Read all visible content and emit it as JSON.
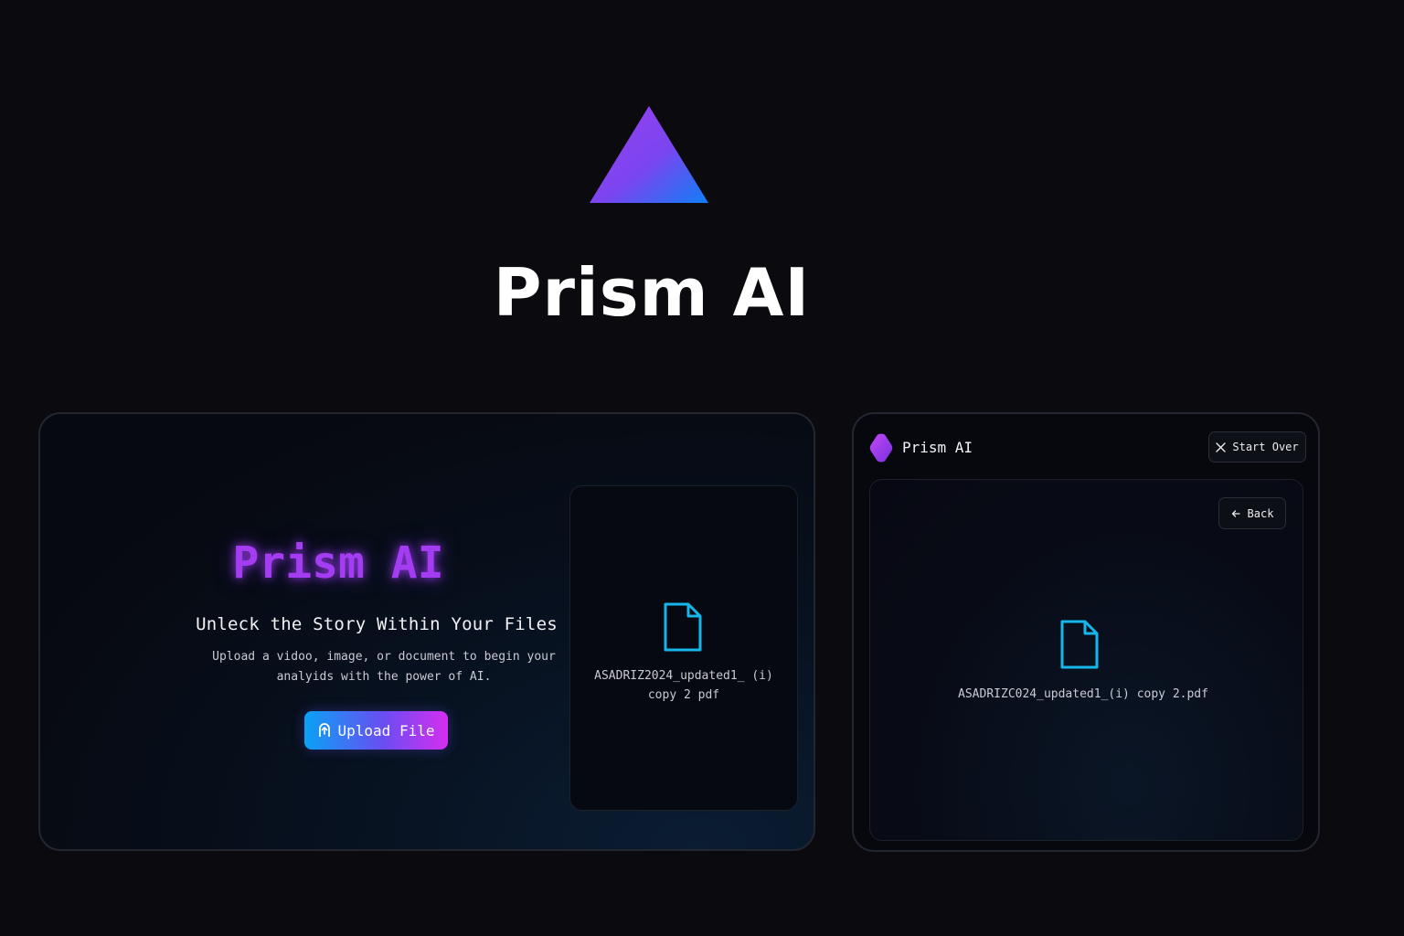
{
  "hero": {
    "logo_icon": "triangle-prism-logo",
    "title": "Prism AI"
  },
  "upload_card": {
    "brand": "Prism AI",
    "tagline": "Unleck the Story Within Your Files",
    "description": "Upload a vidoo, image, or document to begin your analyids with the power of AI.",
    "upload_button": {
      "label": "Upload File",
      "icon": "upload-icon"
    },
    "file_preview": {
      "icon": "file-icon",
      "name": "ASADRIZ2024_updated1_ (i) copy 2 pdf"
    }
  },
  "viewer_card": {
    "header": {
      "brand_icon": "gem-icon",
      "brand": "Prism AI",
      "start_over_label": "Start Over",
      "start_over_icon": "close-icon"
    },
    "back_button": {
      "label": "Back",
      "icon": "arrow-left-icon"
    },
    "file": {
      "icon": "file-icon",
      "name": "ASADRIZC024_updated1_(i) copy 2.pdf"
    }
  },
  "colors": {
    "background": "#0a0a0f",
    "accent_purple": "#a43cf2",
    "accent_blue": "#0aa2f5",
    "accent_magenta": "#d52ef0",
    "file_icon": "#17b6ea"
  }
}
